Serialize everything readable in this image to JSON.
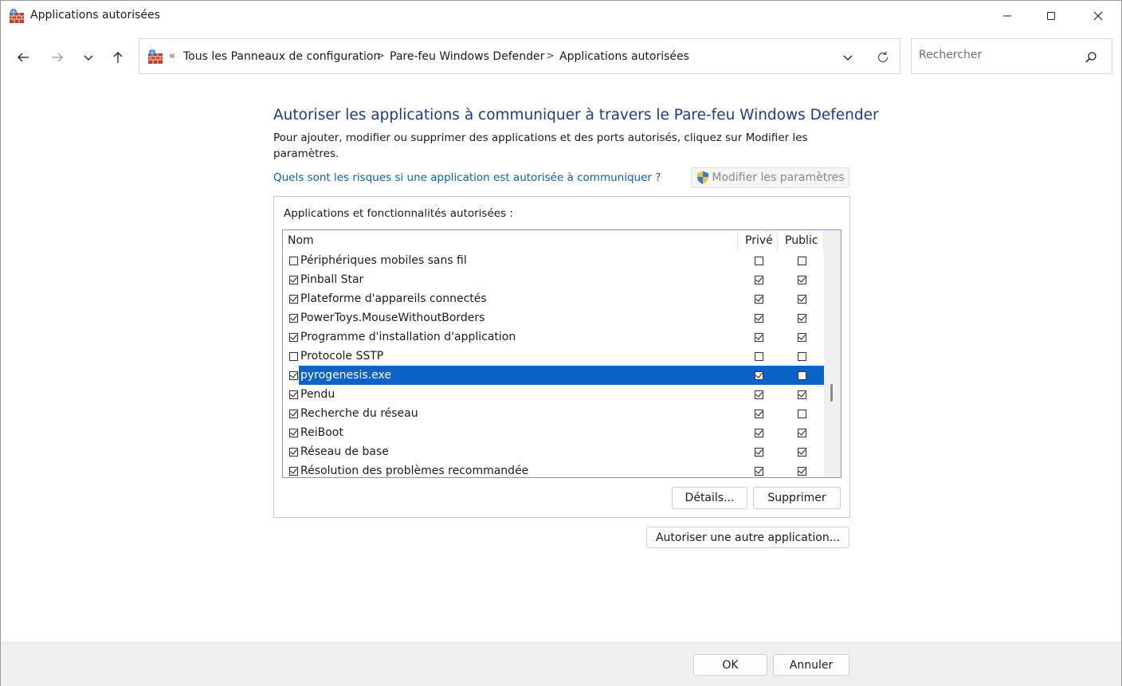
{
  "window": {
    "title": "Applications autorisées"
  },
  "nav": {
    "breadcrumb_prefix": "«",
    "breadcrumbs": [
      "Tous les Panneaux de configuration",
      "Pare-feu Windows Defender",
      "Applications autorisées"
    ],
    "breadcrumb_separator": ">",
    "search_placeholder": "Rechercher"
  },
  "main": {
    "title": "Autoriser les applications à communiquer à travers le Pare-feu Windows Defender",
    "description": "Pour ajouter, modifier ou supprimer des applications et des ports autorisés, cliquez sur Modifier les paramètres.",
    "risk_link": "Quels sont les risques si une application est autorisée à communiquer ?",
    "modify_button": "Modifier les paramètres",
    "group_label": "Applications et fonctionnalités autorisées :",
    "columns": {
      "name": "Nom",
      "private": "Privé",
      "public": "Public"
    },
    "rows": [
      {
        "name": "Périphériques mobiles sans fil",
        "enabled": false,
        "private": false,
        "public": false
      },
      {
        "name": "Pinball Star",
        "enabled": true,
        "private": true,
        "public": true
      },
      {
        "name": "Plateforme d'appareils connectés",
        "enabled": true,
        "private": true,
        "public": true
      },
      {
        "name": "PowerToys.MouseWithoutBorders",
        "enabled": true,
        "private": true,
        "public": true
      },
      {
        "name": "Programme d'installation d'application",
        "enabled": true,
        "private": true,
        "public": true
      },
      {
        "name": "Protocole SSTP",
        "enabled": false,
        "private": false,
        "public": false
      },
      {
        "name": "pyrogenesis.exe",
        "enabled": true,
        "private": true,
        "public": false,
        "selected": true
      },
      {
        "name": "Pendu",
        "enabled": true,
        "private": true,
        "public": true
      },
      {
        "name": "Recherche du réseau",
        "enabled": true,
        "private": true,
        "public": false
      },
      {
        "name": "ReiBoot",
        "enabled": true,
        "private": true,
        "public": true
      },
      {
        "name": "Réseau de base",
        "enabled": true,
        "private": true,
        "public": true
      },
      {
        "name": "Résolution des problèmes recommandée",
        "enabled": true,
        "private": true,
        "public": true
      }
    ],
    "details_button": "Détails...",
    "remove_button": "Supprimer",
    "allow_other_button": "Autoriser une autre application..."
  },
  "footer": {
    "ok_button": "OK",
    "cancel_button": "Annuler"
  },
  "colors": {
    "title_blue": "#1e3c8c",
    "link_blue": "#0a5fb4",
    "selection": "#0a64c8"
  }
}
